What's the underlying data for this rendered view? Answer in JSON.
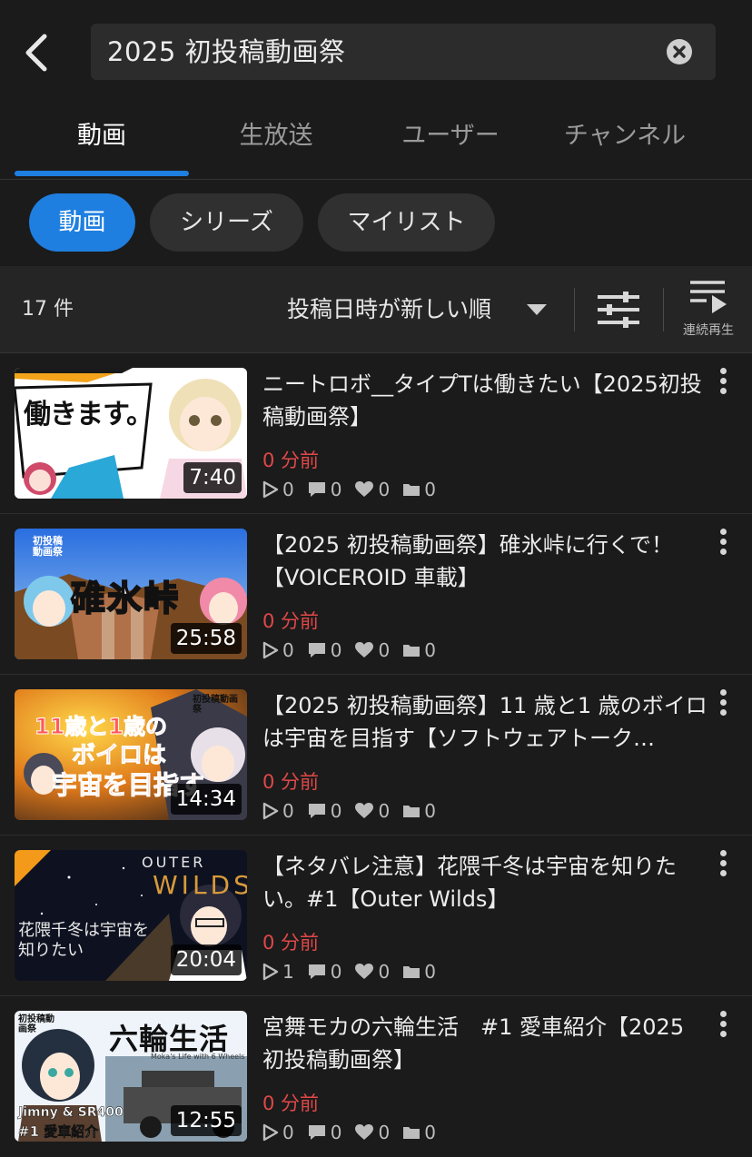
{
  "search": {
    "query": "2025 初投稿動画祭"
  },
  "main_tabs": [
    {
      "label": "動画"
    },
    {
      "label": "生放送"
    },
    {
      "label": "ユーザー"
    },
    {
      "label": "チャンネル"
    }
  ],
  "chips": [
    {
      "label": "動画"
    },
    {
      "label": "シリーズ"
    },
    {
      "label": "マイリスト"
    }
  ],
  "results": {
    "count": "17 件",
    "sort": "投稿日時が新しい順",
    "continuous_label": "連続再生"
  },
  "videos": [
    {
      "title": "ニートロボ__タイプTは働きたい【2025初投稿動画祭】",
      "duration": "7:40",
      "age": "0 分前",
      "views": "0",
      "comments": "0",
      "likes": "0",
      "mylists": "0"
    },
    {
      "title": "【2025 初投稿動画祭】碓氷峠に行くで！【VOICEROID 車載】",
      "duration": "25:58",
      "age": "0 分前",
      "views": "0",
      "comments": "0",
      "likes": "0",
      "mylists": "0"
    },
    {
      "title": "【2025 初投稿動画祭】11 歳と1 歳のボイロは宇宙を目指す【ソフトウェアトーク…",
      "duration": "14:34",
      "age": "0 分前",
      "views": "0",
      "comments": "0",
      "likes": "0",
      "mylists": "0"
    },
    {
      "title": "【ネタバレ注意】花隈千冬は宇宙を知りたい。#1【Outer Wilds】",
      "duration": "20:04",
      "age": "0 分前",
      "views": "1",
      "comments": "0",
      "likes": "0",
      "mylists": "0"
    },
    {
      "title": "宮舞モカの六輪生活　#1 愛車紹介【2025 初投稿動画祭】",
      "duration": "12:55",
      "age": "0 分前",
      "views": "0",
      "comments": "0",
      "likes": "0",
      "mylists": "0"
    }
  ],
  "thumb_texts": {
    "t1_caption": "働きます。",
    "t2_caption": "碓氷峠",
    "t2_badge": "初投稿動画祭",
    "t3_caption_1": "11歳と1歳の",
    "t3_caption_2": "ボイロは",
    "t3_caption_3": "宇宙を目指す",
    "t3_badge": "初投稿動画祭",
    "t4_logo_1": "OUTER",
    "t4_logo_2": "WILDS",
    "t4_caption": "花隈千冬は宇宙を知りたい",
    "t5_caption": "六輪生活",
    "t5_sub": "Jimny & SR400",
    "t5_ep": "#1 愛車紹介",
    "t5_small": "Moka's Life with 6 Wheels",
    "t5_badge": "初投稿動画祭"
  },
  "colors": {
    "accent": "#1e7fe0",
    "age_red": "#e04848",
    "background": "#1b1b1b"
  }
}
